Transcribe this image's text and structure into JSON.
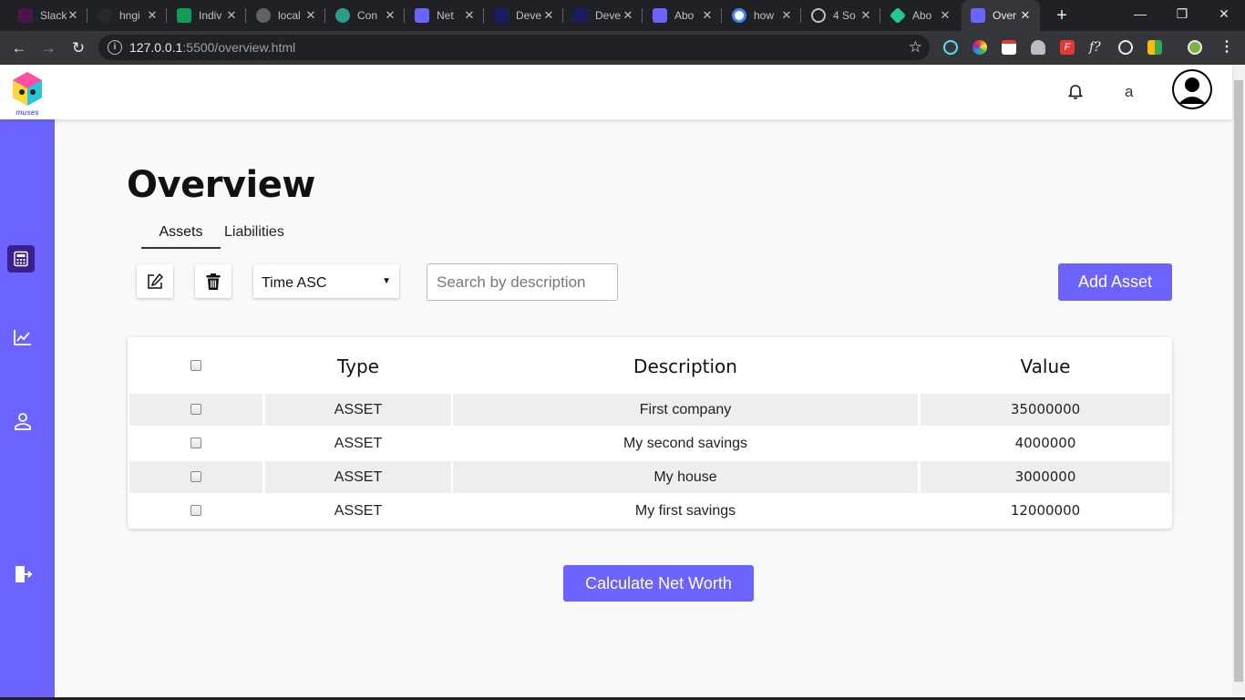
{
  "browser": {
    "tabs": [
      {
        "label": "Slack",
        "color": "#4a154b"
      },
      {
        "label": "hngi",
        "color": "#24292e"
      },
      {
        "label": "Indiv",
        "color": "#0f9d58"
      },
      {
        "label": "local",
        "color": "#5f6368"
      },
      {
        "label": "Con",
        "color": "#61dafb"
      },
      {
        "label": "Net",
        "color": "#6c63ff"
      },
      {
        "label": "Deve",
        "color": "#1a1a5e"
      },
      {
        "label": "Deve",
        "color": "#1a1a5e"
      },
      {
        "label": "Abo",
        "color": "#6c63ff"
      },
      {
        "label": "how",
        "color": "#4285f4"
      },
      {
        "label": "4 So",
        "color": "#5f6368"
      },
      {
        "label": "Abo",
        "color": "#20c997"
      },
      {
        "label": "Over",
        "color": "#6c63ff"
      }
    ],
    "url_host": "127.0.0.1",
    "url_rest": ":5500/overview.html"
  },
  "header": {
    "user_initial": "a"
  },
  "page": {
    "title": "Overview",
    "tabs": {
      "assets": "Assets",
      "liabilities": "Liabilities"
    },
    "sort": {
      "selected": "Time ASC"
    },
    "search": {
      "placeholder": "Search by description"
    },
    "add_button": "Add Asset",
    "table": {
      "headers": [
        "Type",
        "Description",
        "Value"
      ],
      "rows": [
        {
          "type": "ASSET",
          "description": "First company",
          "value": "35000000"
        },
        {
          "type": "ASSET",
          "description": "My second savings",
          "value": "4000000"
        },
        {
          "type": "ASSET",
          "description": "My house",
          "value": "3000000"
        },
        {
          "type": "ASSET",
          "description": "My first savings",
          "value": "12000000"
        }
      ]
    },
    "calc_button": "Calculate Net Worth"
  },
  "colors": {
    "brand": "#6c63ff",
    "sidebar_active": "#3b1f8f"
  }
}
